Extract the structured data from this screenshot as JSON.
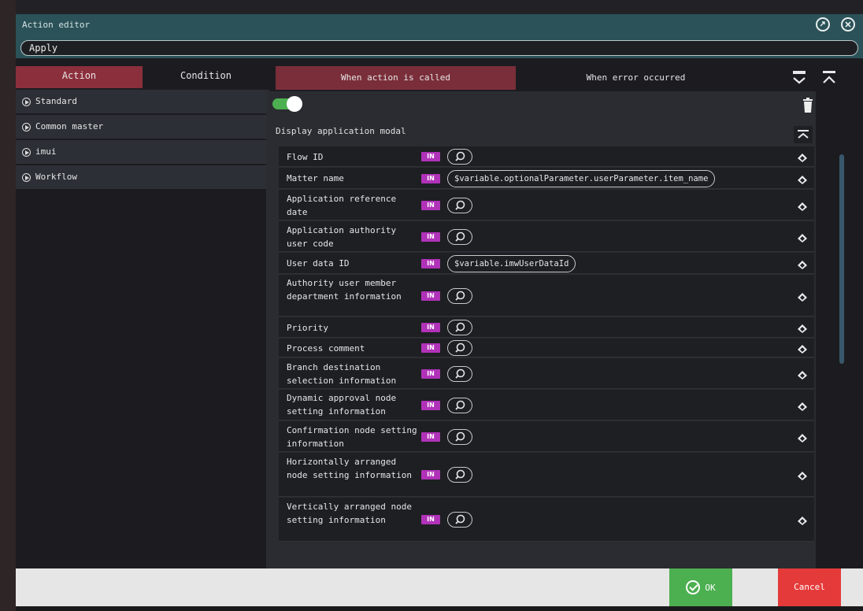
{
  "window": {
    "title": "Action editor",
    "share_icon": "link-icon",
    "close_icon": "close-icon"
  },
  "action_name": {
    "value": "Apply"
  },
  "left_tabs": [
    {
      "label": "Action",
      "active": true
    },
    {
      "label": "Condition",
      "active": false
    }
  ],
  "categories": [
    {
      "label": "Standard",
      "icon": "play-circle-icon"
    },
    {
      "label": "Common master",
      "icon": "play-circle-icon"
    },
    {
      "label": "imui",
      "icon": "play-circle-icon"
    },
    {
      "label": "Workflow",
      "icon": "play-circle-icon"
    }
  ],
  "right_tabs": [
    {
      "label": "When action is called",
      "active": true
    },
    {
      "label": "When error occurred",
      "active": false
    }
  ],
  "action_panel": {
    "enabled": true,
    "title": "Display application modal",
    "in_badge": "IN",
    "rows": [
      {
        "label": "Flow ID",
        "value": ""
      },
      {
        "label": "Matter name",
        "value": "$variable.optionalParameter.userParameter.item_name"
      },
      {
        "label": "Application reference date",
        "value": ""
      },
      {
        "label": "Application authority user code",
        "value": ""
      },
      {
        "label": "User data ID",
        "value": "$variable.imwUserDataId"
      },
      {
        "label": "Authority user member department information",
        "value": ""
      },
      {
        "label": "Priority",
        "value": ""
      },
      {
        "label": "Process comment",
        "value": ""
      },
      {
        "label": "Branch destination selection information",
        "value": ""
      },
      {
        "label": "Dynamic approval node setting information",
        "value": ""
      },
      {
        "label": "Confirmation node setting information",
        "value": ""
      },
      {
        "label": "Horizontally arranged node setting information",
        "value": ""
      },
      {
        "label": "Vertically arranged node setting information",
        "value": ""
      }
    ]
  },
  "footer": {
    "ok_label": "OK",
    "cancel_label": "Cancel"
  },
  "colors": {
    "titlebar": "#2b5258",
    "tab_active": "#8c2f3c",
    "ok": "#4caf50",
    "cancel": "#e53a3a",
    "in_badge": "#b032b8"
  }
}
